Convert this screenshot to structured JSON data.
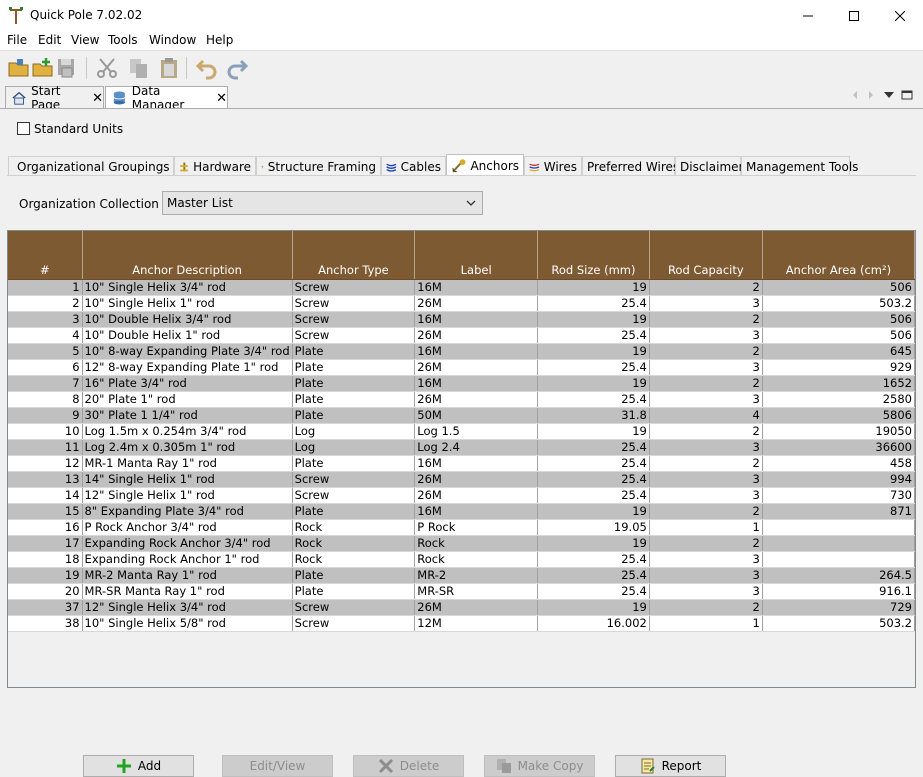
{
  "window": {
    "title": "Quick Pole 7.02.02"
  },
  "menu": {
    "items": [
      "File",
      "Edit",
      "View",
      "Tools",
      "Window",
      "Help"
    ]
  },
  "toolbar": {
    "icons": [
      "open-folder-icon",
      "new-folder-icon",
      "save-icon",
      "cut-icon",
      "copy-icon",
      "paste-icon",
      "undo-icon",
      "redo-icon"
    ]
  },
  "doc_tabs": [
    {
      "label": "Start Page",
      "icon": "home-icon"
    },
    {
      "label": "Data Manager",
      "icon": "database-icon",
      "active": true
    }
  ],
  "standard_units": {
    "label": "Standard Units",
    "checked": false
  },
  "panel_tabs": [
    {
      "label": "Organizational Groupings",
      "icon": "people-icon"
    },
    {
      "label": "Hardware",
      "icon": "hardware-icon"
    },
    {
      "label": "Structure Framing",
      "icon": "framing-icon"
    },
    {
      "label": "Cables",
      "icon": "cables-icon"
    },
    {
      "label": "Anchors",
      "icon": "anchor-icon",
      "active": true
    },
    {
      "label": "Wires",
      "icon": "wires-icon"
    },
    {
      "label": "Preferred Wires"
    },
    {
      "label": "Disclaimer"
    },
    {
      "label": "Management Tools"
    }
  ],
  "org": {
    "label": "Organization Collection",
    "value": "Master List"
  },
  "table": {
    "columns": [
      "#",
      "Anchor Description",
      "Anchor Type",
      "Label",
      "Rod Size (mm)",
      "Rod Capacity",
      "Anchor Area (cm²)"
    ],
    "rows": [
      [
        "1",
        "10\" Single Helix 3/4\" rod",
        "Screw",
        "16M",
        "19",
        "2",
        "506"
      ],
      [
        "2",
        "10\" Single Helix 1\" rod",
        "Screw",
        "26M",
        "25.4",
        "3",
        "503.2"
      ],
      [
        "3",
        "10\" Double Helix 3/4\" rod",
        "Screw",
        "16M",
        "19",
        "2",
        "506"
      ],
      [
        "4",
        "10\" Double Helix 1\" rod",
        "Screw",
        "26M",
        "25.4",
        "3",
        "506"
      ],
      [
        "5",
        "10\" 8-way Expanding Plate 3/4\" rod",
        "Plate",
        "16M",
        "19",
        "2",
        "645"
      ],
      [
        "6",
        "12\" 8-way Expanding Plate 1\" rod",
        "Plate",
        "26M",
        "25.4",
        "3",
        "929"
      ],
      [
        "7",
        "16\" Plate 3/4\" rod",
        "Plate",
        "16M",
        "19",
        "2",
        "1652"
      ],
      [
        "8",
        "20\" Plate 1\" rod",
        "Plate",
        "26M",
        "25.4",
        "3",
        "2580"
      ],
      [
        "9",
        "30\" Plate 1 1/4\" rod",
        "Plate",
        "50M",
        "31.8",
        "4",
        "5806"
      ],
      [
        "10",
        "Log 1.5m x 0.254m 3/4\" rod",
        "Log",
        "Log 1.5",
        "19",
        "2",
        "19050"
      ],
      [
        "11",
        "Log 2.4m x 0.305m 1\" rod",
        "Log",
        "Log 2.4",
        "25.4",
        "3",
        "36600"
      ],
      [
        "12",
        "MR-1 Manta Ray 1\" rod",
        "Plate",
        "16M",
        "25.4",
        "2",
        "458"
      ],
      [
        "13",
        "14\" Single Helix 1\" rod",
        "Screw",
        "26M",
        "25.4",
        "3",
        "994"
      ],
      [
        "14",
        "12\" Single Helix 1\" rod",
        "Screw",
        "26M",
        "25.4",
        "3",
        "730"
      ],
      [
        "15",
        "8\" Expanding Plate 3/4\" rod",
        "Plate",
        "16M",
        "19",
        "2",
        "871"
      ],
      [
        "16",
        "P Rock Anchor 3/4\" rod",
        "Rock",
        "P Rock",
        "19.05",
        "1",
        ""
      ],
      [
        "17",
        "Expanding Rock Anchor 3/4\" rod",
        "Rock",
        "Rock",
        "19",
        "2",
        ""
      ],
      [
        "18",
        "Expanding Rock Anchor 1\" rod",
        "Rock",
        "Rock",
        "25.4",
        "3",
        ""
      ],
      [
        "19",
        "MR-2 Manta Ray 1\" rod",
        "Plate",
        "MR-2",
        "25.4",
        "3",
        "264.5"
      ],
      [
        "20",
        "MR-SR Manta Ray 1\" rod",
        "Plate",
        "MR-SR",
        "25.4",
        "3",
        "916.1"
      ],
      [
        "37",
        "12\" Single Helix 3/4\" rod",
        "Screw",
        "26M",
        "19",
        "2",
        "729"
      ],
      [
        "38",
        "10\" Single Helix 5/8\" rod",
        "Screw",
        "12M",
        "16.002",
        "1",
        "503.2"
      ]
    ]
  },
  "buttons": {
    "add": "Add",
    "edit_view": "Edit/View",
    "delete": "Delete",
    "make_copy": "Make Copy",
    "report": "Report"
  },
  "colors": {
    "header_brown": "#7e5a33",
    "row_alt": "#c0c0c0",
    "add_green": "#22a323"
  }
}
